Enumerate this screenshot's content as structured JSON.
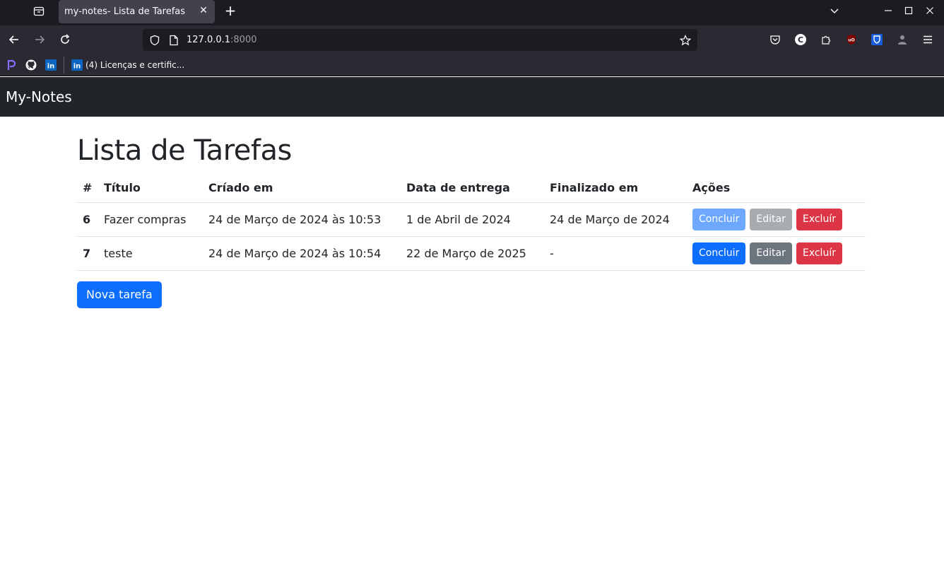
{
  "browser": {
    "tab_title": "my-notes- Lista de Tarefas",
    "url_host": "127.0.0.1",
    "url_port": ":8000",
    "bookmark_label": "(4) Licenças e certific..."
  },
  "app": {
    "brand": "My-Notes",
    "page_title": "Lista de Tarefas",
    "new_task_label": "Nova tarefa"
  },
  "table": {
    "headers": {
      "num": "#",
      "title": "Título",
      "created": "Críado em",
      "due": "Data de entrega",
      "finished": "Finalizado em",
      "actions": "Ações"
    },
    "rows": [
      {
        "id": "6",
        "title": "Fazer compras",
        "created": "24 de Março de 2024 às 10:53",
        "due": "1 de Abril de 2024",
        "finished": "24 de Março de 2024",
        "complete_label": "Concluir",
        "edit_label": "Editar",
        "delete_label": "Excluír",
        "completed": true
      },
      {
        "id": "7",
        "title": "teste",
        "created": "24 de Março de 2024 às 10:54",
        "due": "22 de Março de 2025",
        "finished": "-",
        "complete_label": "Concluir",
        "edit_label": "Editar",
        "delete_label": "Excluír",
        "completed": false
      }
    ]
  },
  "colors": {
    "primary": "#0d6efd",
    "secondary": "#6c757d",
    "danger": "#dc3545",
    "navbar_dark": "#212529"
  }
}
